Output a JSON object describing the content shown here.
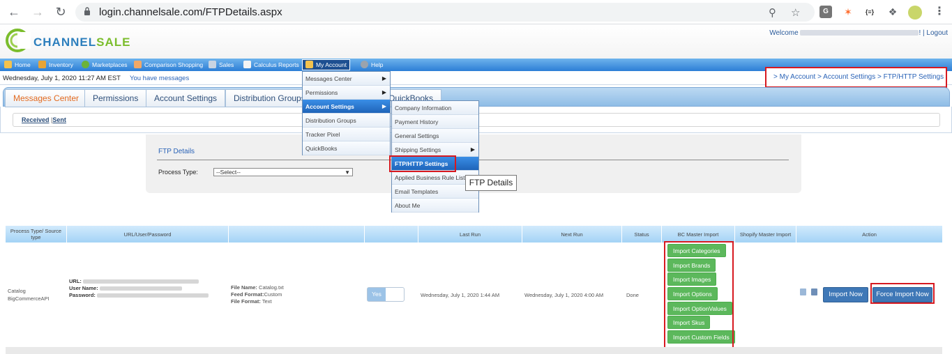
{
  "browser": {
    "url": "login.channelsale.com/FTPDetails.aspx"
  },
  "header": {
    "logo_text_1": "CHANNEL",
    "logo_text_2": "SALE",
    "welcome_prefix": "Welcome",
    "welcome_suffix": "! |",
    "logout": "Logout"
  },
  "nav": {
    "items": [
      {
        "label": "Home"
      },
      {
        "label": "Inventory"
      },
      {
        "label": "Marketplaces"
      },
      {
        "label": "Comparison Shopping"
      },
      {
        "label": "Sales"
      },
      {
        "label": "Calculus Reports"
      },
      {
        "label": "My Account"
      },
      {
        "label": "Help"
      }
    ]
  },
  "datebar": {
    "date": "Wednesday, July 1, 2020 11:27 AM EST",
    "messages": "You have messages"
  },
  "breadcrumb": "> My Account > Account Settings > FTP/HTTP Settings",
  "tabs": [
    {
      "label": "Messages Center"
    },
    {
      "label": "Permissions"
    },
    {
      "label": "Account Settings"
    },
    {
      "label": "Distribution Groups"
    },
    {
      "label": "QuickBooks"
    }
  ],
  "subtabs": {
    "received": "Received",
    "separator": "|",
    "sent": "Sent"
  },
  "menu1": [
    {
      "label": "Messages Center"
    },
    {
      "label": "Permissions"
    },
    {
      "label": "Account Settings"
    },
    {
      "label": "Distribution Groups"
    },
    {
      "label": "Tracker Pixel"
    },
    {
      "label": "QuickBooks"
    }
  ],
  "menu2": [
    {
      "label": "Company Information"
    },
    {
      "label": "Payment History"
    },
    {
      "label": "General Settings"
    },
    {
      "label": "Shipping Settings"
    },
    {
      "label": "FTP/HTTP Settings"
    },
    {
      "label": "Applied Business Rule List"
    },
    {
      "label": "Email Templates"
    },
    {
      "label": "About Me"
    }
  ],
  "tooltip": "FTP Details",
  "ftp_panel": {
    "title": "FTP Details",
    "process_label": "Process Type:",
    "process_value": "--Select--"
  },
  "table": {
    "headers": [
      "Process Type/ Source type",
      "URL/User/Password",
      "",
      "",
      "Last Run",
      "Next Run",
      "Status",
      "BC Master Import",
      "Shopify Master Import",
      "Action"
    ],
    "row": {
      "process_type": "Catalog",
      "source_type": "BigCommerceAPI",
      "url_label": "URL:",
      "user_label": "User Name:",
      "password_label": "Password:",
      "file_name_label": "File Name:",
      "file_name": "Catalog.txt",
      "feed_format_label": "Feed Format:",
      "feed_format": "Custom",
      "file_format_label": "File Format:",
      "file_format": "Text",
      "toggle": "Yes",
      "last_run": "Wednesday, July 1, 2020 1:44 AM",
      "next_run": "Wednesday, July 1, 2020 4:00 AM",
      "status": "Done",
      "bc_buttons": [
        "Import Categories",
        "Import Brands",
        "Import Images",
        "Import Options",
        "Import OptionValues",
        "Import Skus",
        "Import Custom Fields"
      ],
      "import_now": "Import Now",
      "force_import_now": "Force Import Now"
    }
  },
  "colors": {
    "nav_blue": "#2c7ed6",
    "highlight_red": "#d71920",
    "button_green": "#5cb85c",
    "button_blue": "#3f78b7"
  }
}
